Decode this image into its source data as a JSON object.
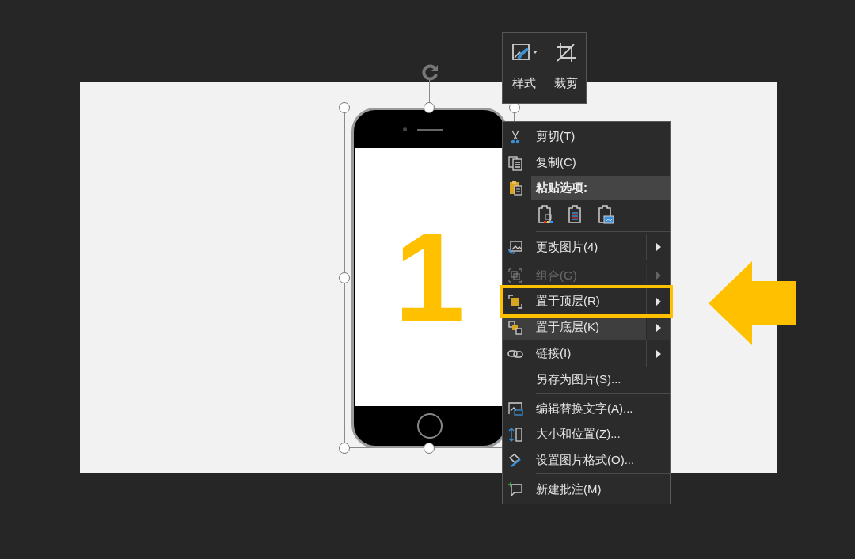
{
  "toolbar": {
    "buttons": [
      {
        "label": "样式",
        "dropdown": true
      },
      {
        "label": "裁剪",
        "dropdown": false
      }
    ]
  },
  "slide": {
    "phone_text": "1",
    "selected": true
  },
  "menu": {
    "items": [
      {
        "kind": "item",
        "label": "剪切(T)",
        "submenu": false,
        "disabled": false,
        "divider": false,
        "highlighted": false,
        "hovered": false
      },
      {
        "kind": "item",
        "label": "复制(C)",
        "submenu": false,
        "disabled": false,
        "divider": false,
        "highlighted": false,
        "hovered": false
      },
      {
        "kind": "header",
        "label": "粘贴选项:"
      },
      {
        "kind": "paste_options"
      },
      {
        "kind": "item",
        "label": "更改图片(4)",
        "submenu": true,
        "disabled": false,
        "divider": true,
        "highlighted": false,
        "hovered": false
      },
      {
        "kind": "item",
        "label": "组合(G)",
        "submenu": true,
        "disabled": true,
        "divider": true,
        "highlighted": false,
        "hovered": false
      },
      {
        "kind": "item",
        "label": "置于顶层(R)",
        "submenu": true,
        "disabled": false,
        "divider": false,
        "highlighted": true,
        "hovered": false
      },
      {
        "kind": "item",
        "label": "置于底层(K)",
        "submenu": true,
        "disabled": false,
        "divider": false,
        "highlighted": false,
        "hovered": true
      },
      {
        "kind": "item",
        "label": "链接(I)",
        "submenu": true,
        "disabled": false,
        "divider": false,
        "highlighted": false,
        "hovered": false
      },
      {
        "kind": "item",
        "label": "另存为图片(S)...",
        "submenu": false,
        "disabled": false,
        "divider": false,
        "highlighted": false,
        "hovered": false
      },
      {
        "kind": "item",
        "label": "编辑替换文字(A)...",
        "submenu": false,
        "disabled": false,
        "divider": true,
        "highlighted": false,
        "hovered": false
      },
      {
        "kind": "item",
        "label": "大小和位置(Z)...",
        "submenu": false,
        "disabled": false,
        "divider": false,
        "highlighted": false,
        "hovered": false
      },
      {
        "kind": "item",
        "label": "设置图片格式(O)...",
        "submenu": false,
        "disabled": false,
        "divider": false,
        "highlighted": false,
        "hovered": false
      },
      {
        "kind": "item",
        "label": "新建批注(M)",
        "submenu": false,
        "disabled": false,
        "divider": true,
        "highlighted": false,
        "hovered": false
      }
    ]
  }
}
